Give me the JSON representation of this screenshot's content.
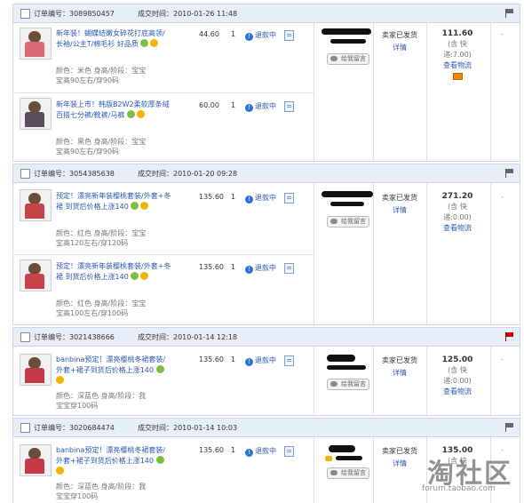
{
  "labels": {
    "order_no": "订单编号：",
    "deal_time": "成交时间：",
    "refunding": "退款中",
    "memo": "给我留言",
    "shipped": "卖家已发货",
    "detail": "详情",
    "logistics": "查看物流",
    "dash": "-"
  },
  "orders": [
    {
      "number": "3089850457",
      "time": "2010-01-26 11:48",
      "total": "111.60",
      "shipping_a": "(含 快",
      "shipping_b": "递:7.00)",
      "flag": "gray",
      "items": [
        {
          "title": "新年装！蝴蝶结嫩女碎花打底高领/长袖/公主T/棉毛衫 好品质",
          "attr1": "颜色：米色   身高/阶段：宝宝",
          "attr2": "宝高90左右/穿90码",
          "price": "44.60",
          "qty": "1"
        },
        {
          "title": "新年装上市！韩版B2W2柔软厚条绒百搭七分裤/靴裤/马裤",
          "attr1": "颜色：黑色   身高/阶段：宝宝",
          "attr2": "宝高90左右/穿90码",
          "price": "60.00",
          "qty": "1"
        }
      ]
    },
    {
      "number": "3054385638",
      "time": "2010-01-20 09:28",
      "total": "271.20",
      "shipping_a": "(含 快",
      "shipping_b": "递:0.00)",
      "flag": "gray",
      "items": [
        {
          "title": "预定！漂亮新年装樱桃套装/外套+冬裙 到货后价格上涨140",
          "attr1": "颜色：红色   身高/阶段：宝宝",
          "attr2": "宝高120左右/穿120码",
          "price": "135.60",
          "qty": "1"
        },
        {
          "title": "预定！漂亮新年装樱桃套装/外套+冬裙 到货后价格上涨140",
          "attr1": "颜色：红色   身高/阶段：宝宝",
          "attr2": "宝高100左右/穿100码",
          "price": "135.60",
          "qty": "1"
        }
      ]
    },
    {
      "number": "3021438666",
      "time": "2010-01-14 12:18",
      "total": "125.00",
      "shipping_a": "(含 快",
      "shipping_b": "递:0.00)",
      "flag": "red",
      "items": [
        {
          "title": "banbina预定！漂亮樱桃冬裙套装/外套+裙子到货后价格上涨140",
          "attr1": "颜色：深蓝色   身高/阶段：我",
          "attr2": "宝宝穿100码",
          "price": "135.60",
          "qty": "1"
        }
      ]
    },
    {
      "number": "3020684474",
      "time": "2010-01-14 10:03",
      "total": "135.00",
      "shipping_a": "(含 快",
      "shipping_b": "",
      "flag": "gray",
      "items": [
        {
          "title": "banbina预定！漂亮樱桃冬裙套装/外套+裙子到货后价格上涨140",
          "attr1": "颜色：深蓝色   身高/阶段：我",
          "attr2": "宝宝穿100码",
          "price": "135.60",
          "qty": "1"
        }
      ]
    }
  ],
  "watermark": {
    "big": "淘社区",
    "small": "forum.taobao.com"
  }
}
